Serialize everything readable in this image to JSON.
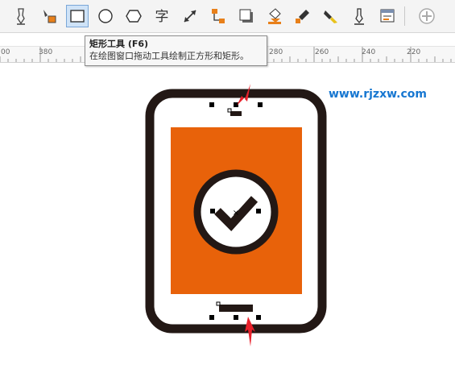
{
  "toolbar": {
    "tools": [
      {
        "name": "freehand-pick-icon"
      },
      {
        "name": "shape-fill-icon"
      },
      {
        "name": "rectangle-tool-icon",
        "active": true
      },
      {
        "name": "ellipse-tool-icon"
      },
      {
        "name": "polygon-tool-icon"
      },
      {
        "name": "text-tool-icon",
        "glyph": "字"
      },
      {
        "name": "dimension-tool-icon"
      },
      {
        "name": "connector-tool-icon"
      },
      {
        "name": "drop-shadow-icon"
      },
      {
        "name": "transparency-icon"
      },
      {
        "name": "eyedropper-icon"
      },
      {
        "name": "interactive-fill-icon"
      },
      {
        "name": "smart-fill-icon"
      },
      {
        "name": "outline-tool-icon"
      },
      {
        "name": "add-tool-icon"
      }
    ]
  },
  "ruler": {
    "labels": [
      "00",
      "380",
      "280",
      "260",
      "240",
      "220"
    ]
  },
  "tooltip": {
    "title": "矩形工具 (F6)",
    "description": "在绘图窗口拖动工具绘制正方形和矩形。"
  },
  "watermark": "www.rjzxw.com",
  "colors": {
    "accent_orange": "#e8620a",
    "outline_dark": "#231815",
    "arrow_red": "#e8202a",
    "watermark_blue": "#1777d1"
  }
}
